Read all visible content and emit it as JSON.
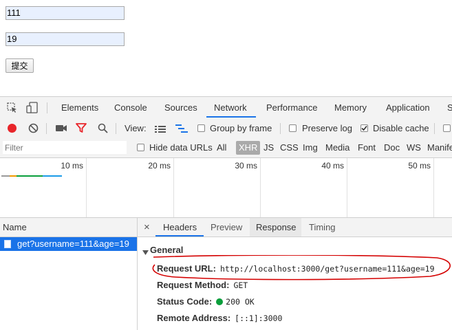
{
  "form": {
    "username_value": "111",
    "age_value": "19",
    "submit_label": "提交"
  },
  "devtools": {
    "tabs": [
      "Elements",
      "Console",
      "Sources",
      "Network",
      "Performance",
      "Memory",
      "Application",
      "S"
    ],
    "active_tab": "Network",
    "toolbar": {
      "view_label": "View:",
      "group_by_frame": "Group by frame",
      "preserve_log": "Preserve log",
      "disable_cache": "Disable cache"
    },
    "filter": {
      "placeholder": "Filter",
      "hide_data_urls": "Hide data URLs",
      "types": [
        "All",
        "XHR",
        "JS",
        "CSS",
        "Img",
        "Media",
        "Font",
        "Doc",
        "WS",
        "Manife"
      ],
      "active_type": "XHR"
    },
    "timeline": {
      "ticks": [
        "10 ms",
        "20 ms",
        "30 ms",
        "40 ms",
        "50 ms"
      ]
    },
    "requests": {
      "name_header": "Name",
      "items": [
        "get?username=111&age=19"
      ]
    },
    "detail": {
      "close_glyph": "×",
      "tabs": [
        "Headers",
        "Preview",
        "Response",
        "Timing"
      ],
      "active_tab": "Headers",
      "section": "General",
      "request_url_label": "Request URL:",
      "request_url": "http://localhost:3000/get?username=111&age=19",
      "request_method_label": "Request Method:",
      "request_method": "GET",
      "status_code_label": "Status Code:",
      "status_code": "200 OK",
      "remote_address_label": "Remote Address:",
      "remote_address": "[::1]:3000"
    },
    "colors": {
      "accent": "#1a73e8",
      "record": "#e8252a",
      "status_ok": "#0a9e3b",
      "annotation": "#d40000"
    }
  }
}
